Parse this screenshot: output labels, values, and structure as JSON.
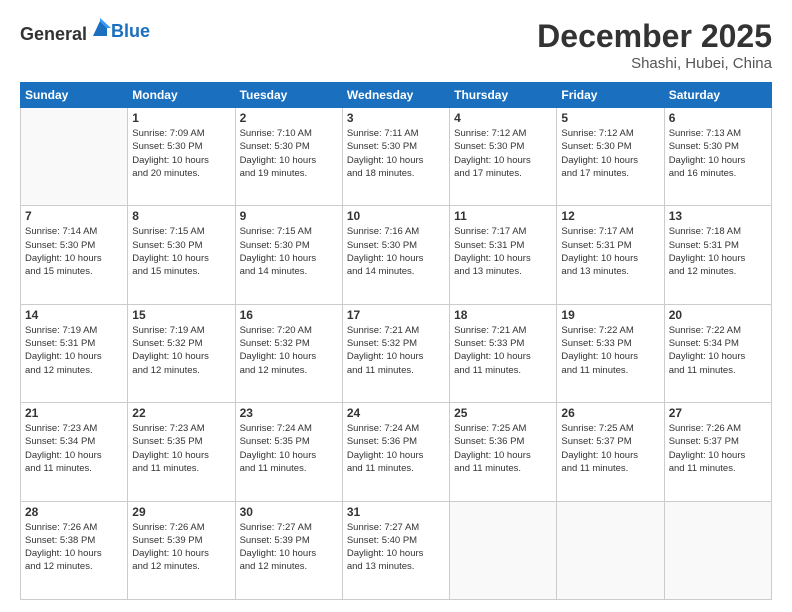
{
  "logo": {
    "general": "General",
    "blue": "Blue"
  },
  "header": {
    "month": "December 2025",
    "location": "Shashi, Hubei, China"
  },
  "weekdays": [
    "Sunday",
    "Monday",
    "Tuesday",
    "Wednesday",
    "Thursday",
    "Friday",
    "Saturday"
  ],
  "weeks": [
    [
      {
        "day": "",
        "info": ""
      },
      {
        "day": "1",
        "info": "Sunrise: 7:09 AM\nSunset: 5:30 PM\nDaylight: 10 hours\nand 20 minutes."
      },
      {
        "day": "2",
        "info": "Sunrise: 7:10 AM\nSunset: 5:30 PM\nDaylight: 10 hours\nand 19 minutes."
      },
      {
        "day": "3",
        "info": "Sunrise: 7:11 AM\nSunset: 5:30 PM\nDaylight: 10 hours\nand 18 minutes."
      },
      {
        "day": "4",
        "info": "Sunrise: 7:12 AM\nSunset: 5:30 PM\nDaylight: 10 hours\nand 17 minutes."
      },
      {
        "day": "5",
        "info": "Sunrise: 7:12 AM\nSunset: 5:30 PM\nDaylight: 10 hours\nand 17 minutes."
      },
      {
        "day": "6",
        "info": "Sunrise: 7:13 AM\nSunset: 5:30 PM\nDaylight: 10 hours\nand 16 minutes."
      }
    ],
    [
      {
        "day": "7",
        "info": "Sunrise: 7:14 AM\nSunset: 5:30 PM\nDaylight: 10 hours\nand 15 minutes."
      },
      {
        "day": "8",
        "info": "Sunrise: 7:15 AM\nSunset: 5:30 PM\nDaylight: 10 hours\nand 15 minutes."
      },
      {
        "day": "9",
        "info": "Sunrise: 7:15 AM\nSunset: 5:30 PM\nDaylight: 10 hours\nand 14 minutes."
      },
      {
        "day": "10",
        "info": "Sunrise: 7:16 AM\nSunset: 5:30 PM\nDaylight: 10 hours\nand 14 minutes."
      },
      {
        "day": "11",
        "info": "Sunrise: 7:17 AM\nSunset: 5:31 PM\nDaylight: 10 hours\nand 13 minutes."
      },
      {
        "day": "12",
        "info": "Sunrise: 7:17 AM\nSunset: 5:31 PM\nDaylight: 10 hours\nand 13 minutes."
      },
      {
        "day": "13",
        "info": "Sunrise: 7:18 AM\nSunset: 5:31 PM\nDaylight: 10 hours\nand 12 minutes."
      }
    ],
    [
      {
        "day": "14",
        "info": "Sunrise: 7:19 AM\nSunset: 5:31 PM\nDaylight: 10 hours\nand 12 minutes."
      },
      {
        "day": "15",
        "info": "Sunrise: 7:19 AM\nSunset: 5:32 PM\nDaylight: 10 hours\nand 12 minutes."
      },
      {
        "day": "16",
        "info": "Sunrise: 7:20 AM\nSunset: 5:32 PM\nDaylight: 10 hours\nand 12 minutes."
      },
      {
        "day": "17",
        "info": "Sunrise: 7:21 AM\nSunset: 5:32 PM\nDaylight: 10 hours\nand 11 minutes."
      },
      {
        "day": "18",
        "info": "Sunrise: 7:21 AM\nSunset: 5:33 PM\nDaylight: 10 hours\nand 11 minutes."
      },
      {
        "day": "19",
        "info": "Sunrise: 7:22 AM\nSunset: 5:33 PM\nDaylight: 10 hours\nand 11 minutes."
      },
      {
        "day": "20",
        "info": "Sunrise: 7:22 AM\nSunset: 5:34 PM\nDaylight: 10 hours\nand 11 minutes."
      }
    ],
    [
      {
        "day": "21",
        "info": "Sunrise: 7:23 AM\nSunset: 5:34 PM\nDaylight: 10 hours\nand 11 minutes."
      },
      {
        "day": "22",
        "info": "Sunrise: 7:23 AM\nSunset: 5:35 PM\nDaylight: 10 hours\nand 11 minutes."
      },
      {
        "day": "23",
        "info": "Sunrise: 7:24 AM\nSunset: 5:35 PM\nDaylight: 10 hours\nand 11 minutes."
      },
      {
        "day": "24",
        "info": "Sunrise: 7:24 AM\nSunset: 5:36 PM\nDaylight: 10 hours\nand 11 minutes."
      },
      {
        "day": "25",
        "info": "Sunrise: 7:25 AM\nSunset: 5:36 PM\nDaylight: 10 hours\nand 11 minutes."
      },
      {
        "day": "26",
        "info": "Sunrise: 7:25 AM\nSunset: 5:37 PM\nDaylight: 10 hours\nand 11 minutes."
      },
      {
        "day": "27",
        "info": "Sunrise: 7:26 AM\nSunset: 5:37 PM\nDaylight: 10 hours\nand 11 minutes."
      }
    ],
    [
      {
        "day": "28",
        "info": "Sunrise: 7:26 AM\nSunset: 5:38 PM\nDaylight: 10 hours\nand 12 minutes."
      },
      {
        "day": "29",
        "info": "Sunrise: 7:26 AM\nSunset: 5:39 PM\nDaylight: 10 hours\nand 12 minutes."
      },
      {
        "day": "30",
        "info": "Sunrise: 7:27 AM\nSunset: 5:39 PM\nDaylight: 10 hours\nand 12 minutes."
      },
      {
        "day": "31",
        "info": "Sunrise: 7:27 AM\nSunset: 5:40 PM\nDaylight: 10 hours\nand 13 minutes."
      },
      {
        "day": "",
        "info": ""
      },
      {
        "day": "",
        "info": ""
      },
      {
        "day": "",
        "info": ""
      }
    ]
  ]
}
